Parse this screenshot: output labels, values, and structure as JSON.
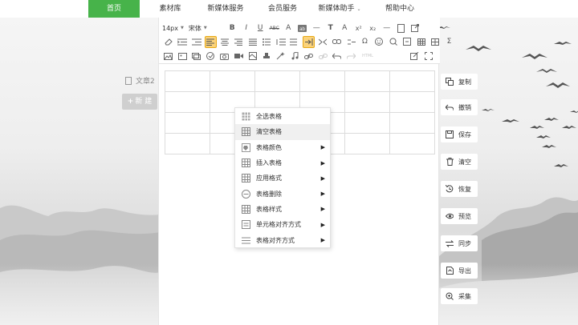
{
  "nav": {
    "items": [
      {
        "label": "首页",
        "active": true
      },
      {
        "label": "素材库"
      },
      {
        "label": "新媒体服务"
      },
      {
        "label": "会员服务"
      },
      {
        "label": "新媒体助手",
        "caret": "⌄"
      },
      {
        "label": "帮助中心"
      }
    ]
  },
  "sidebar": {
    "doc_label": "文章2",
    "new_button": "新 建",
    "new_plus": "+"
  },
  "toolbar": {
    "font_size": "14px",
    "font_family": "宋体",
    "html_label": "HTML",
    "sigma": "Σ",
    "omega": "Ω",
    "bold": "B",
    "italic": "I",
    "underline": "U",
    "abc": "ABC",
    "font_a": "A",
    "superscript": "x²",
    "subscript": "x₂",
    "clear_format": "T"
  },
  "context_menu": {
    "items": [
      {
        "label": "全选表格",
        "icon": "table-grid-icon",
        "submenu": false
      },
      {
        "label": "清空表格",
        "icon": "table-grid-icon",
        "submenu": false,
        "hover": true
      },
      {
        "label": "表格颜色",
        "icon": "paint-bucket-icon",
        "submenu": true
      },
      {
        "label": "插入表格",
        "icon": "table-grid-icon",
        "submenu": true
      },
      {
        "label": "应用格式",
        "icon": "table-grid-icon",
        "submenu": true
      },
      {
        "label": "表格删除",
        "icon": "minus-circle-icon",
        "submenu": true
      },
      {
        "label": "表格样式",
        "icon": "table-grid-icon",
        "submenu": true
      },
      {
        "label": "单元格对齐方式",
        "icon": "align-box-icon",
        "submenu": true
      },
      {
        "label": "表格对齐方式",
        "icon": "align-lines-icon",
        "submenu": true
      }
    ],
    "arrow": "▶"
  },
  "actions": {
    "items": [
      {
        "label": "复制",
        "icon": "copy-icon"
      },
      {
        "label": "撤销",
        "icon": "undo-icon"
      },
      {
        "label": "保存",
        "icon": "save-icon"
      },
      {
        "label": "清空",
        "icon": "trash-icon"
      },
      {
        "label": "恢复",
        "icon": "restore-icon"
      },
      {
        "label": "预览",
        "icon": "eye-icon"
      },
      {
        "label": "同步",
        "icon": "sync-icon"
      },
      {
        "label": "导出",
        "icon": "export-icon"
      },
      {
        "label": "采集",
        "icon": "search-collect-icon"
      }
    ]
  },
  "colors": {
    "accent": "#47b34a",
    "active_tool": "#fbd37a"
  }
}
